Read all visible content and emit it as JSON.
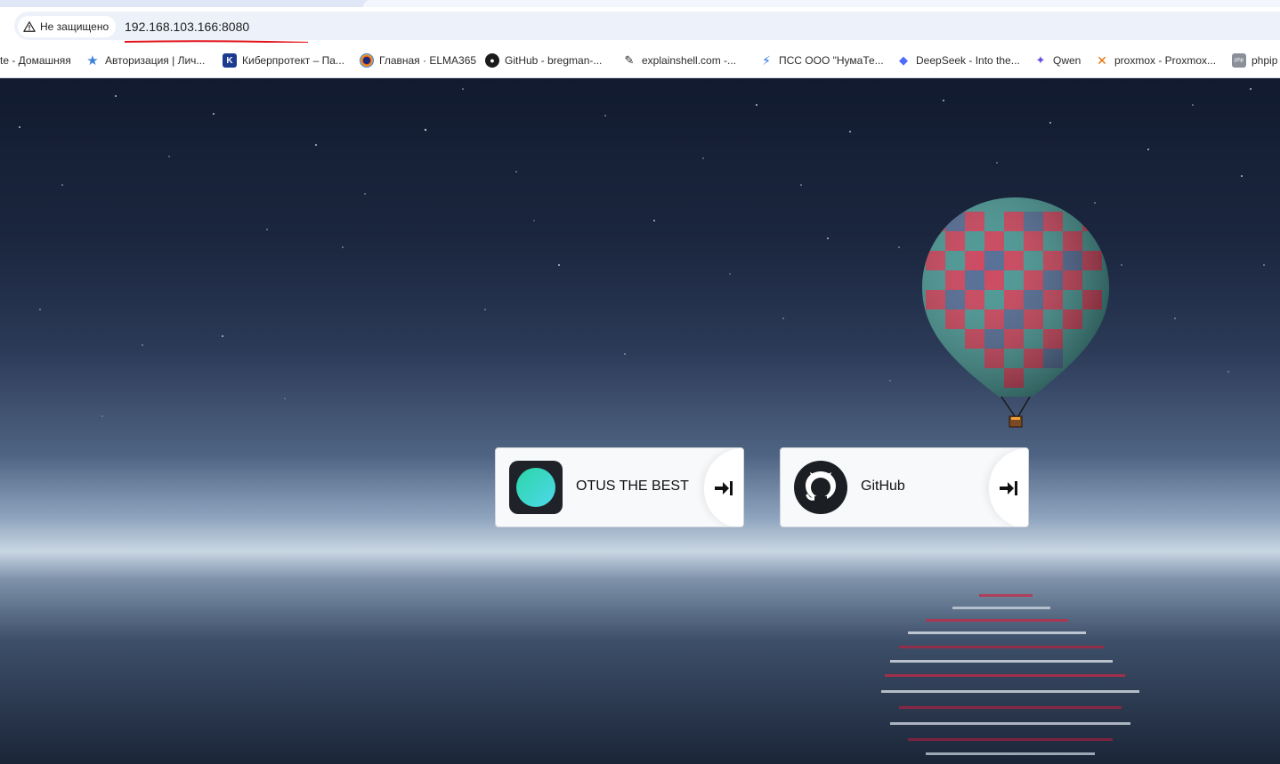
{
  "browser": {
    "security_label": "Не защищено",
    "url": "192.168.103.166:8080",
    "bookmarks": [
      {
        "label": "te - Домашняя",
        "icon": "none"
      },
      {
        "label": "Авторизация | Лич...",
        "icon": "star-icon"
      },
      {
        "label": "Киберпротект – Па...",
        "icon": "k-logo-icon"
      },
      {
        "label": "Главная · ELMA365",
        "icon": "elma-icon"
      },
      {
        "label": "GitHub - bregman-...",
        "icon": "github-icon"
      },
      {
        "label": "explainshell.com -...",
        "icon": "shell-icon"
      },
      {
        "label": "ПСС ООО \"НумаТе...",
        "icon": "bolt-icon"
      },
      {
        "label": "DeepSeek - Into the...",
        "icon": "deepseek-icon"
      },
      {
        "label": "Qwen",
        "icon": "qwen-icon"
      },
      {
        "label": "proxmox - Proxmox...",
        "icon": "proxmox-icon"
      },
      {
        "label": "phpip",
        "icon": "phpipam-icon"
      }
    ]
  },
  "cards": [
    {
      "title": "OTUS THE BEST",
      "icon": "otus-circle-icon"
    },
    {
      "title": "GitHub",
      "icon": "github-icon"
    }
  ],
  "colors": {
    "otus_teal": "#34d1c0",
    "card_bg": "#f8f9fb",
    "url_underline": "#e0121b"
  }
}
